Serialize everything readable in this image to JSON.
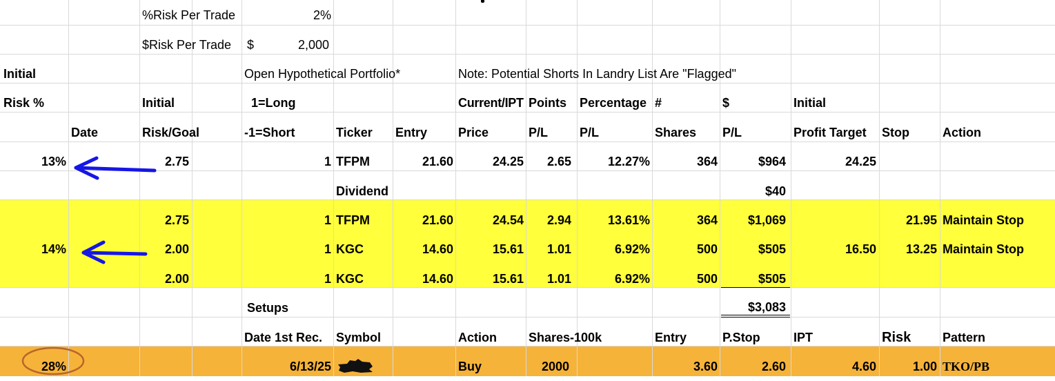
{
  "colors": {
    "yellow_band": "#ffff3b",
    "orange_band": "#f6b33a",
    "arrow": "#1616e6",
    "circle": "#b8662a"
  },
  "params": {
    "risk_pct_label": "%Risk Per Trade",
    "risk_pct_value": "2%",
    "risk_dollar_label": "$Risk Per Trade",
    "risk_dollar_sign": "$",
    "risk_dollar_value": "2,000"
  },
  "notes": {
    "initial": "Initial",
    "risk_pct": "Risk %",
    "portfolio": "Open Hypothetical Portfolio*",
    "shorts_note": "Note: Potential Shorts In Landry List Are \"Flagged\""
  },
  "headers": {
    "initial_top": "Initial",
    "long": "1=Long",
    "current": "Current/IPT",
    "points": "Points",
    "percentage": "Percentage",
    "hash": "#",
    "dollar": "$",
    "initial_right": "Initial",
    "date": "Date",
    "risk_goal": "Risk/Goal",
    "short": "-1=Short",
    "ticker": "Ticker",
    "entry": "Entry",
    "price": "Price",
    "pl1": "P/L",
    "pl2": "P/L",
    "shares": "Shares",
    "pl3": "P/L",
    "profit_target": "Profit Target",
    "stop": "Stop",
    "action": "Action"
  },
  "row1": {
    "riskpct": "13%",
    "riskgoal": "2.75",
    "dir": "1",
    "ticker": "TFPM",
    "entry": "21.60",
    "price": "24.25",
    "points": "2.65",
    "pct": "12.27%",
    "shares": "364",
    "pl": "$964",
    "target": "24.25",
    "stop": "",
    "action": ""
  },
  "dividend": {
    "label": "Dividend",
    "value": "$40"
  },
  "yrow1": {
    "riskpct": "",
    "riskgoal": "2.75",
    "dir": "1",
    "ticker": "TFPM",
    "entry": "21.60",
    "price": "24.54",
    "points": "2.94",
    "pct": "13.61%",
    "shares": "364",
    "pl": "$1,069",
    "target": "",
    "stop": "21.95",
    "action": "Maintain Stop"
  },
  "yrow2": {
    "riskpct": "14%",
    "riskgoal": "2.00",
    "dir": "1",
    "ticker": "KGC",
    "entry": "14.60",
    "price": "15.61",
    "points": "1.01",
    "pct": "6.92%",
    "shares": "500",
    "pl": "$505",
    "target": "16.50",
    "stop": "13.25",
    "action": "Maintain Stop"
  },
  "yrow3": {
    "riskpct": "",
    "riskgoal": "2.00",
    "dir": "1",
    "ticker": "KGC",
    "entry": "14.60",
    "price": "15.61",
    "points": "1.01",
    "pct": "6.92%",
    "shares": "500",
    "pl": "$505",
    "target": "",
    "stop": "",
    "action": ""
  },
  "setups": {
    "label": "Setups",
    "total": "$3,083"
  },
  "setup_headers": {
    "date": "Date 1st Rec.",
    "symbol": "Symbol",
    "action": "Action",
    "shares": "Shares-100k",
    "entry": "Entry",
    "pstop": "P.Stop",
    "ipt": "IPT",
    "risk": "Risk",
    "pattern": "Pattern"
  },
  "setup_row": {
    "riskpct": "28%",
    "date": "6/13/25",
    "action": "Buy",
    "shares": "2000",
    "entry": "3.60",
    "pstop": "2.60",
    "ipt": "4.60",
    "risk": "1.00",
    "pattern": "TKO/PB"
  }
}
